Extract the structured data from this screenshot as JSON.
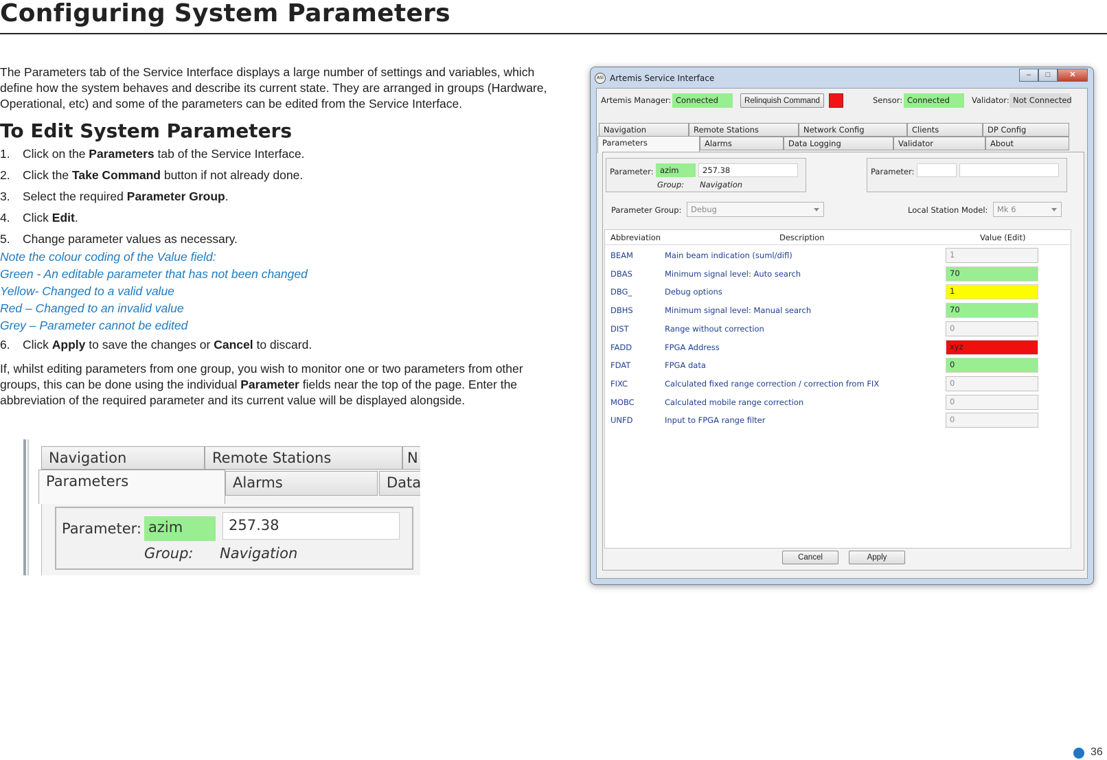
{
  "doc": {
    "title": "Configuring System Parameters",
    "intro": "The Parameters tab of the Service Interface displays a large number of settings and variables, which define how the system behaves and describe its current state. They are arranged in groups (Hardware, Operational, etc) and some of the parameters can be edited from the Service Interface.",
    "section_heading": "To Edit System Parameters",
    "steps": [
      {
        "num": "1.",
        "pre": "Click on the ",
        "bold": "Parameters",
        "post": " tab of the Service Interface."
      },
      {
        "num": "2.",
        "pre": "Click the ",
        "bold": "Take Command",
        "post": " button if not already done."
      },
      {
        "num": "3.",
        "pre": "Select the required ",
        "bold": "Parameter Group",
        "post": "."
      },
      {
        "num": "4.",
        "pre": "Click ",
        "bold": "Edit",
        "post": "."
      },
      {
        "num": "5.",
        "pre": "Change parameter values as necessary.",
        "bold": "",
        "post": ""
      }
    ],
    "notes": [
      "Note the colour coding of the Value field:",
      "Green - An editable parameter that has not been changed",
      "Yellow- Changed to a valid value",
      "Red – Changed to an invalid value",
      "Grey – Parameter cannot be edited"
    ],
    "step6": {
      "num": "6.",
      "pre": "Click ",
      "bold1": "Apply",
      "mid": " to save the changes or ",
      "bold2": "Cancel",
      "post": " to discard."
    },
    "closing": {
      "pre": "If, whilst editing parameters from one group, you wish to monitor one or two parameters from other groups, this can be done using the individual ",
      "bold": "Parameter",
      "post": " fields near the top of the page. Enter the abbreviation of the required parameter and its current value will be displayed alongside."
    },
    "page_number": "36"
  },
  "zoom": {
    "tabs_top": [
      "Navigation",
      "Remote Stations",
      "N"
    ],
    "tabs_bottom": [
      "Parameters",
      "Alarms",
      "Data"
    ],
    "param_label": "Parameter:",
    "param_abbrev": "azim",
    "param_value": "257.38",
    "group_label": "Group:",
    "group_value": "Navigation"
  },
  "window": {
    "title": "Artemis Service Interface",
    "icon_text": "ASI",
    "controls": {
      "minimize": "–",
      "maximize": "□",
      "close": "✕"
    },
    "status": {
      "manager_label": "Artemis Manager:",
      "manager_value": "Connected",
      "relinquish_label": "Relinquish Command",
      "sensor_label": "Sensor:",
      "sensor_value": "Connected",
      "validator_label": "Validator:",
      "validator_value": "Not Connected"
    },
    "tabs_row1": [
      "Navigation",
      "Remote Stations",
      "Network Config",
      "Clients",
      "DP Config"
    ],
    "tabs_row2": [
      "Parameters",
      "Alarms",
      "Data Logging",
      "Validator",
      "About"
    ],
    "param1": {
      "label": "Parameter:",
      "abbrev": "azim",
      "value": "257.38",
      "group_label": "Group:",
      "group_value": "Navigation"
    },
    "param2": {
      "label": "Parameter:",
      "abbrev": "",
      "value": ""
    },
    "group_select_label": "Parameter Group:",
    "group_select_value": "Debug",
    "model_label": "Local Station Model:",
    "model_value": "Mk 6",
    "grid_headers": [
      "Abbreviation",
      "Description",
      "Value (Edit)"
    ],
    "rows": [
      {
        "abbr": "BEAM",
        "desc": "Main beam indication (suml/difl)",
        "value": "1",
        "state": "grey"
      },
      {
        "abbr": "DBAS",
        "desc": "Minimum signal level: Auto search",
        "value": "70",
        "state": "green"
      },
      {
        "abbr": "DBG_",
        "desc": "Debug options",
        "value": "1",
        "state": "yellow"
      },
      {
        "abbr": "DBHS",
        "desc": "Minimum signal level: Manual search",
        "value": "70",
        "state": "green"
      },
      {
        "abbr": "DIST",
        "desc": "Range without correction",
        "value": "0",
        "state": "grey"
      },
      {
        "abbr": "FADD",
        "desc": "FPGA Address",
        "value": "xyz",
        "state": "red"
      },
      {
        "abbr": "FDAT",
        "desc": "FPGA data",
        "value": "0",
        "state": "green"
      },
      {
        "abbr": "FIXC",
        "desc": "Calculated fixed range correction / correction from FIX",
        "value": "0",
        "state": "grey"
      },
      {
        "abbr": "MOBC",
        "desc": "Calculated mobile range correction",
        "value": "0",
        "state": "grey"
      },
      {
        "abbr": "UNFD",
        "desc": "Input to FPGA range filter",
        "value": "0",
        "state": "grey"
      }
    ],
    "cancel_label": "Cancel",
    "apply_label": "Apply"
  }
}
